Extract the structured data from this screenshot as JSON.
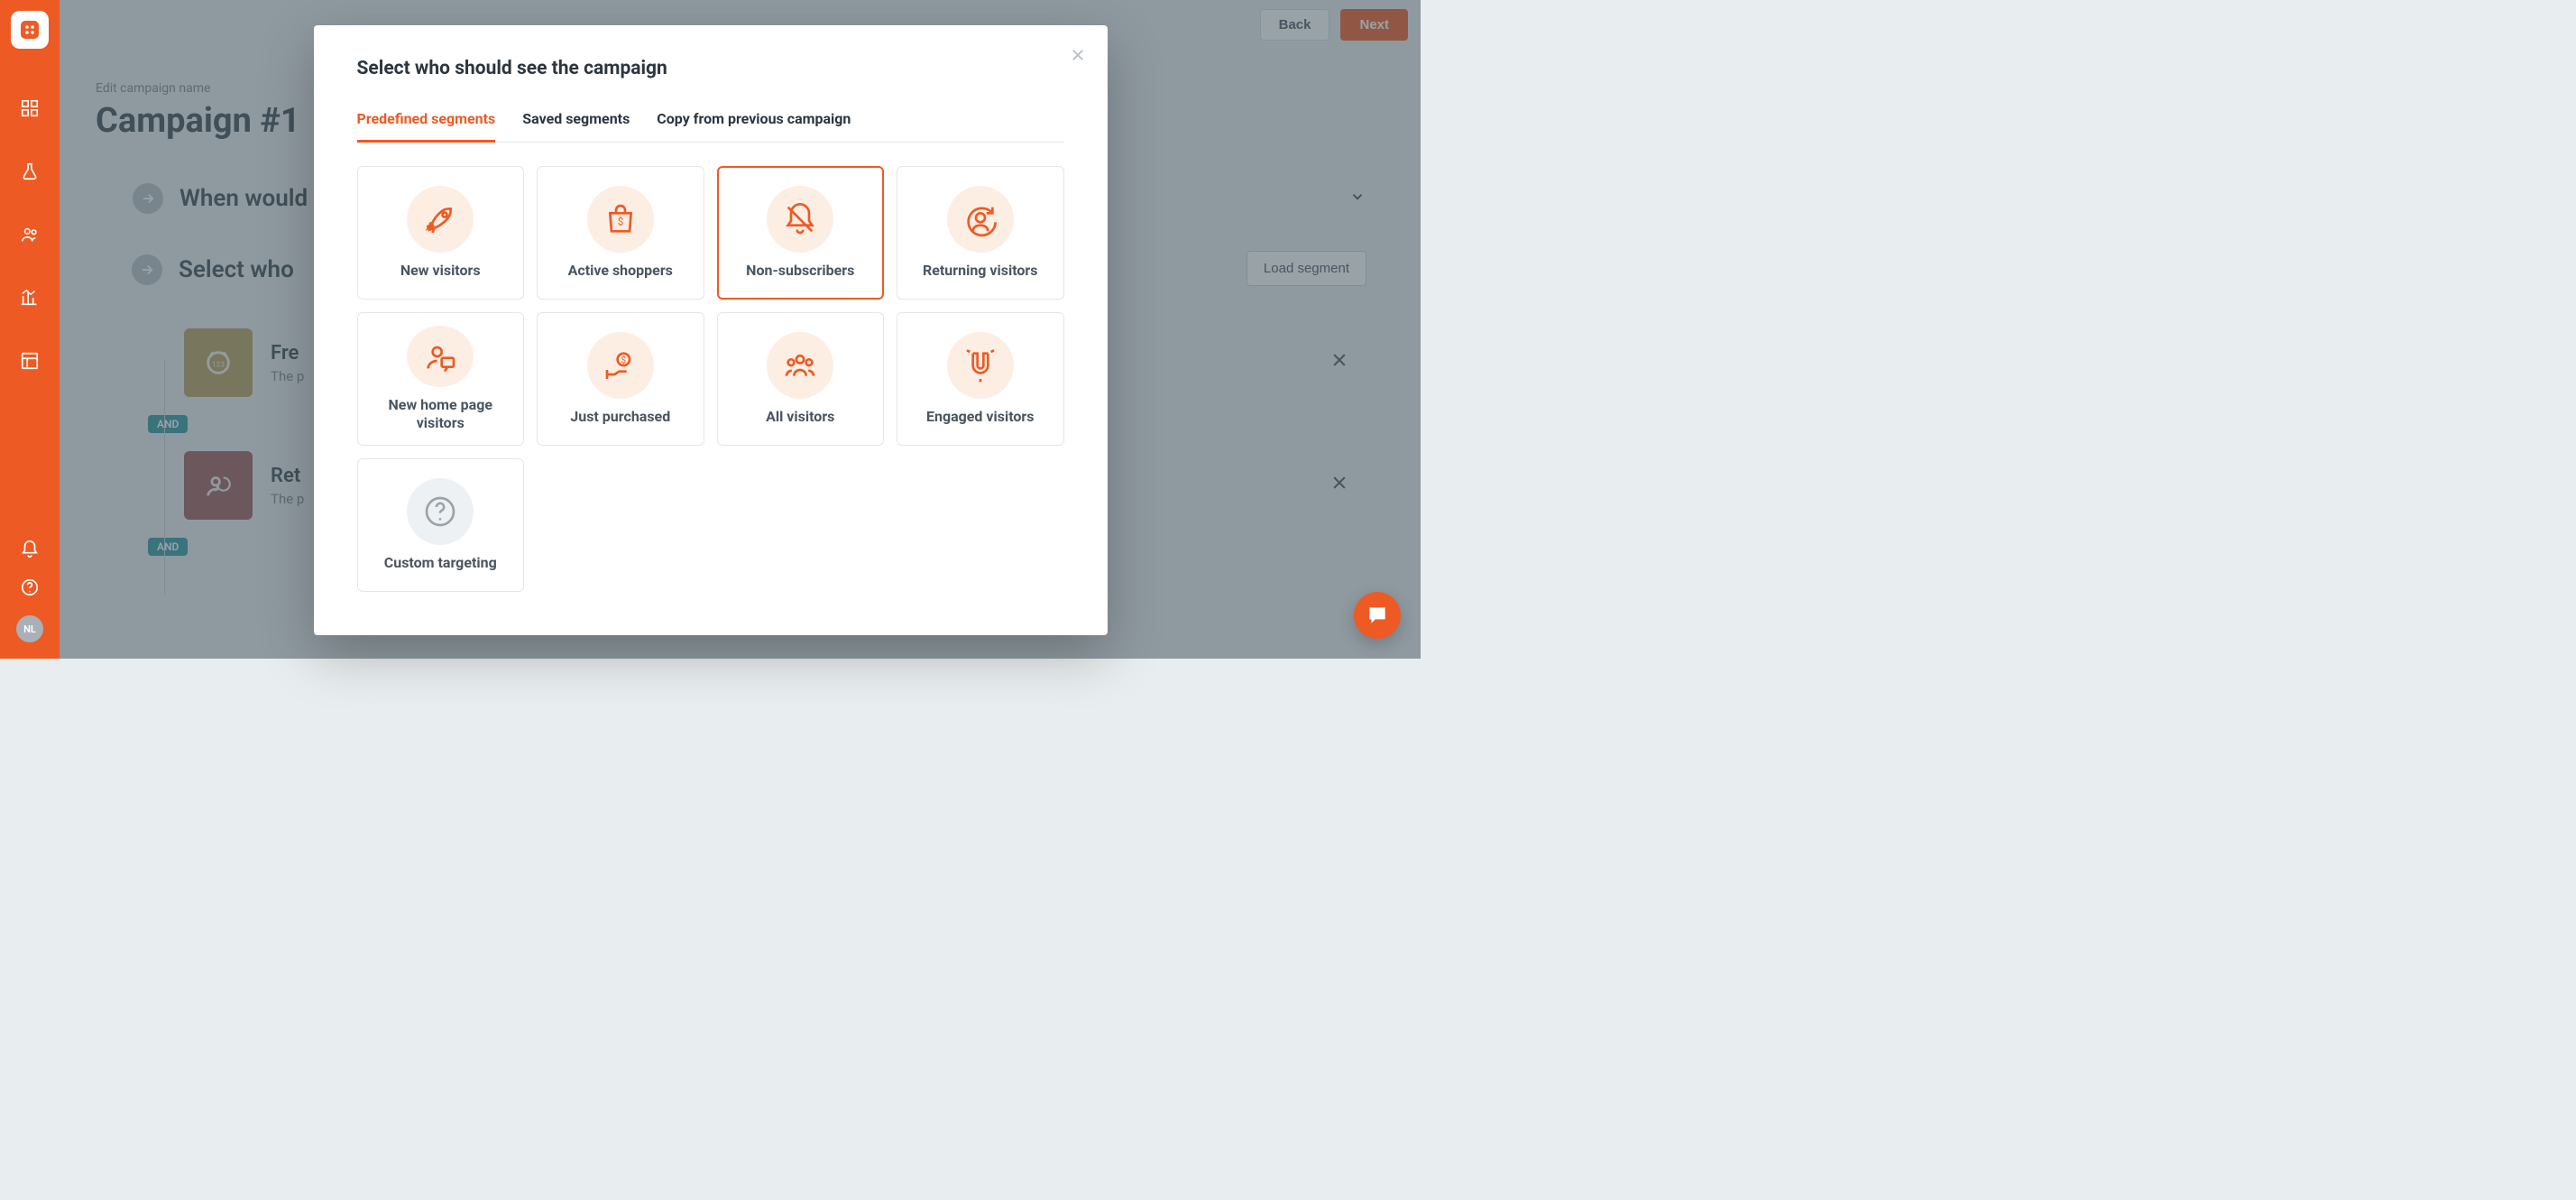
{
  "sidebar": {
    "avatar_initials": "NL"
  },
  "header": {
    "back_label": "Back",
    "next_label": "Next",
    "edit_label": "Edit campaign name",
    "title": "Campaign #1"
  },
  "sections": {
    "when": {
      "title": "When would"
    },
    "who": {
      "title": "Select who",
      "load_segment": "Load segment"
    }
  },
  "rules": {
    "and_label": "AND",
    "freq": {
      "title": "Fre",
      "sub": "The p"
    },
    "ret": {
      "title": "Ret",
      "sub": "The p"
    }
  },
  "modal": {
    "title": "Select who should see the campaign",
    "tabs": {
      "predefined": "Predefined segments",
      "saved": "Saved segments",
      "copy": "Copy from previous campaign"
    },
    "segments": {
      "new_visitors": "New visitors",
      "active_shoppers": "Active shoppers",
      "non_subscribers": "Non-subscribers",
      "returning_visitors": "Returning visitors",
      "new_home": "New home page visitors",
      "just_purchased": "Just purchased",
      "all_visitors": "All visitors",
      "engaged_visitors": "Engaged visitors",
      "custom_targeting": "Custom targeting"
    }
  }
}
